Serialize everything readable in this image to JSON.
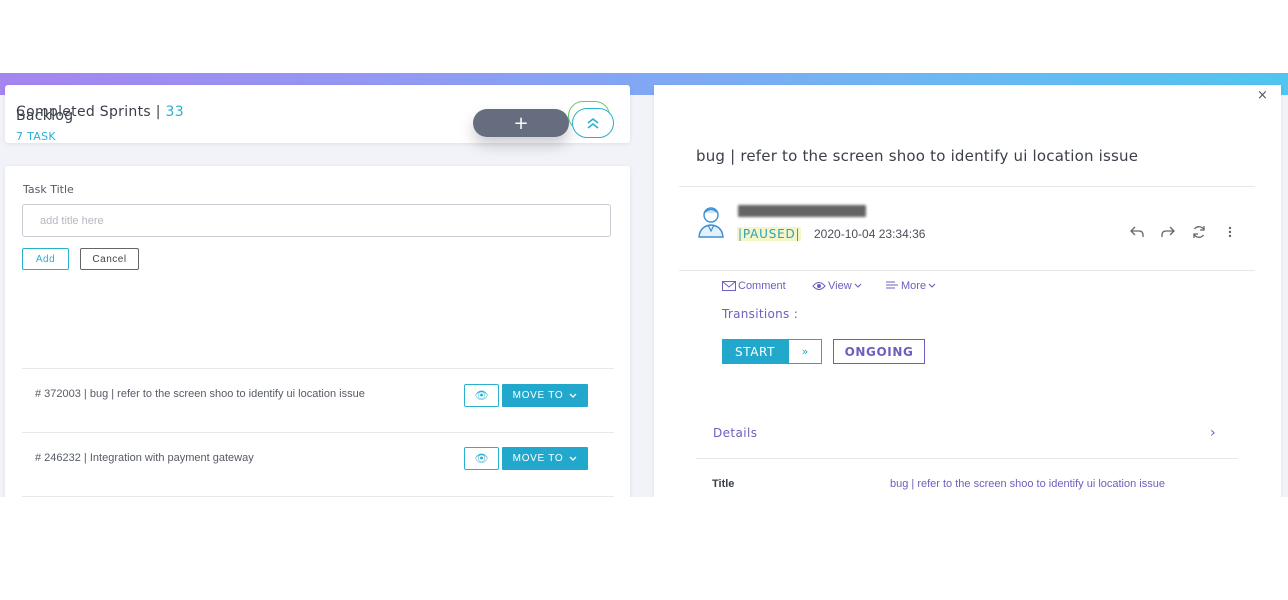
{
  "completed_sprints": {
    "label": "Completed Sprints |",
    "count": "33"
  },
  "backlog": {
    "title": "Backlog",
    "task_count": "7 TASK",
    "add_label": "+",
    "form": {
      "field_label": "Task Title",
      "placeholder": "add title here",
      "value": "",
      "add_button": "Add",
      "cancel_button": "Cancel"
    },
    "tasks": [
      {
        "text": "# 372003 | bug | refer to the screen shoo to identify ui location issue",
        "move_label": "MOVE TO"
      },
      {
        "text": "# 246232 | Integration with payment gateway",
        "move_label": "MOVE TO"
      }
    ]
  },
  "detail": {
    "close_label": "×",
    "title": "bug | refer to the screen shoo to identify ui location issue",
    "status": "|PAUSED|",
    "timestamp": "2020-10-04 23:34:36",
    "actions": [
      {
        "icon": "reply-icon"
      },
      {
        "icon": "forward-icon"
      },
      {
        "icon": "refresh-icon"
      },
      {
        "icon": "more-vertical-icon"
      }
    ],
    "links": {
      "comment": "Comment",
      "view": "View",
      "more": "More"
    },
    "transitions_label": "Transitions :",
    "start_label": "START",
    "next_label": "»",
    "ongoing_label": "ONGOING",
    "details_label": "Details",
    "fields": [
      {
        "label": "Title",
        "value": "bug | refer to the screen shoo to identify ui location issue"
      }
    ]
  },
  "colors": {
    "accent": "#22a8cc",
    "purple": "#6c5fbf",
    "green": "#5cb85c"
  }
}
